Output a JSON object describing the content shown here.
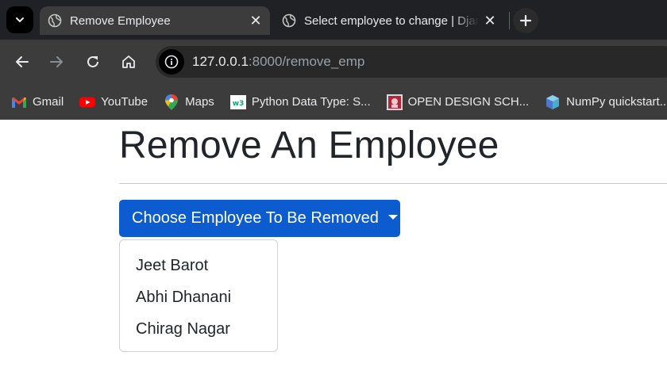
{
  "browser": {
    "tabs": [
      {
        "title": "Remove Employee",
        "active": true
      },
      {
        "title": "Select employee to change | Django site admin",
        "active": false
      }
    ],
    "url_host": "127.0.0.1",
    "url_path": ":8000/remove_emp",
    "bookmarks": [
      {
        "label": "Gmail",
        "icon": "gmail-icon"
      },
      {
        "label": "YouTube",
        "icon": "youtube-icon"
      },
      {
        "label": "Maps",
        "icon": "maps-icon"
      },
      {
        "label": "Python Data Type: S...",
        "icon": "w3schools-icon"
      },
      {
        "label": "OPEN DESIGN SCH...",
        "icon": "open-design-icon"
      },
      {
        "label": "NumPy quickstart...",
        "icon": "numpy-icon"
      }
    ]
  },
  "page": {
    "title": "Remove An Employee",
    "dropdown": {
      "label": "Choose Employee To Be Removed",
      "items": [
        "Jeet Barot",
        "Abhi Dhanani",
        "Chirag Nagar"
      ]
    }
  },
  "colors": {
    "primary_button": "#0d5ccf",
    "chrome_dark": "#202124",
    "chrome_toolbar": "#3c3c3c"
  }
}
